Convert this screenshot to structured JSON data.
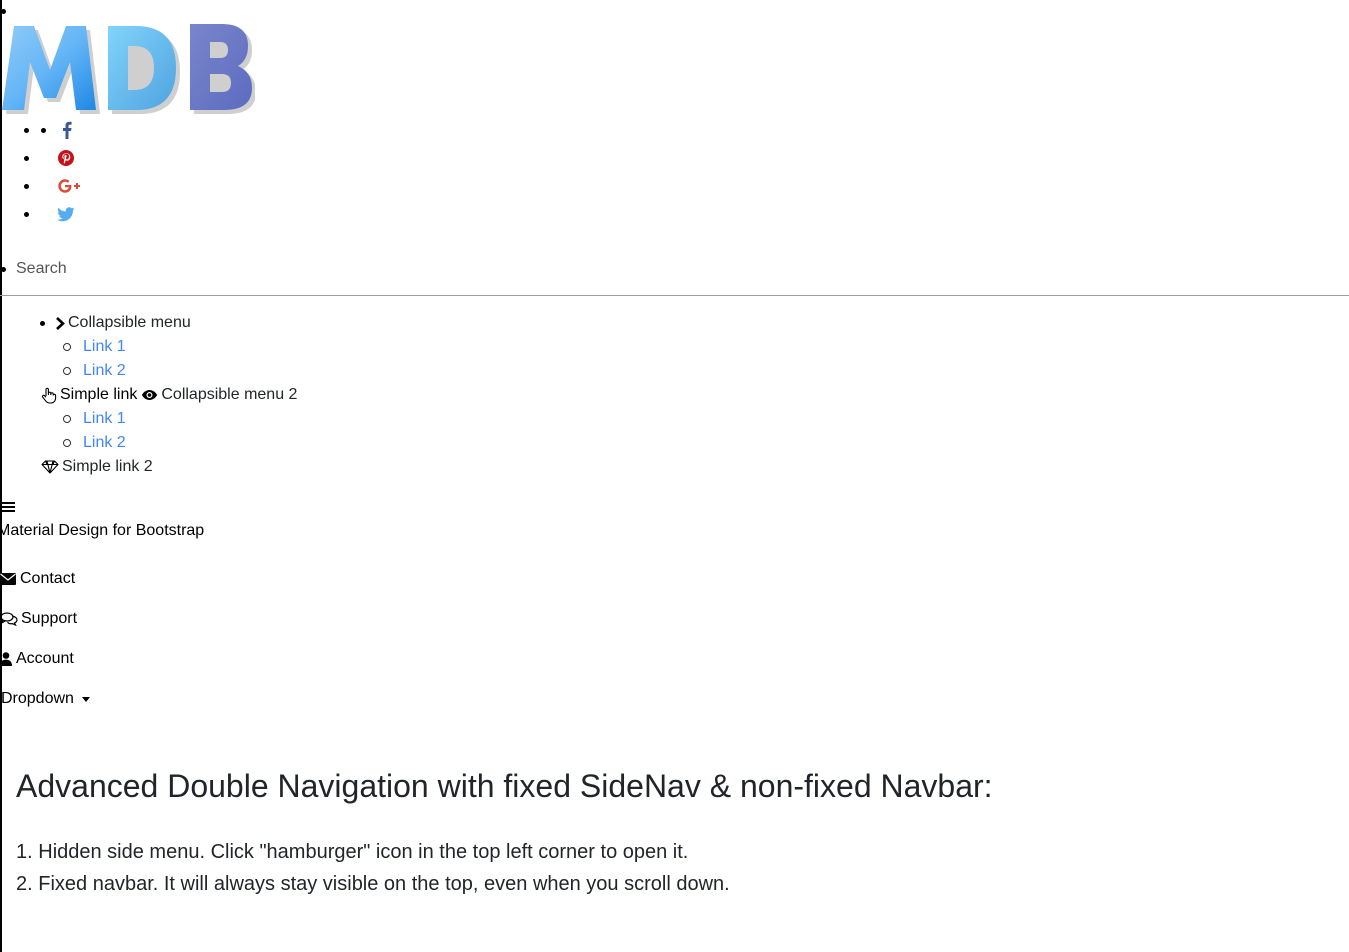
{
  "logo": {
    "letters": [
      "M",
      "D",
      "B"
    ],
    "colors": {
      "light_blue": "#64b5f6",
      "mid_blue": "#2196f3",
      "indigo": "#5c6bc0"
    }
  },
  "social": [
    {
      "icon": "facebook-icon",
      "color": "#3b5998"
    },
    {
      "icon": "pinterest-icon",
      "color": "#c61118"
    },
    {
      "icon": "google-plus-icon",
      "color": "#dd4b39"
    },
    {
      "icon": "twitter-icon",
      "color": "#55acee"
    }
  ],
  "search": {
    "placeholder": "Search"
  },
  "sidenav": {
    "collapsible_1": {
      "label": "Collapsible menu",
      "links": [
        "Link 1",
        "Link 2"
      ]
    },
    "simple_link": "Simple link",
    "collapsible_2": {
      "label": "Collapsible menu 2",
      "links": [
        "Link 1",
        "Link 2"
      ]
    },
    "simple_link_2": "Simple link 2"
  },
  "navbar": {
    "brand": "Material Design for Bootstrap",
    "items": {
      "contact": "Contact",
      "support": "Support",
      "account": "Account",
      "dropdown": "Dropdown"
    }
  },
  "content": {
    "title": "Advanced Double Navigation with fixed SideNav & non-fixed Navbar:",
    "points": [
      "Hidden side menu. Click \"hamburger\" icon in the top left corner to open it.",
      "Fixed navbar. It will always stay visible on the top, even when you scroll down."
    ]
  },
  "colors": {
    "link": "#4285f4",
    "text": "#212529",
    "divider": "#9e9e9e"
  }
}
